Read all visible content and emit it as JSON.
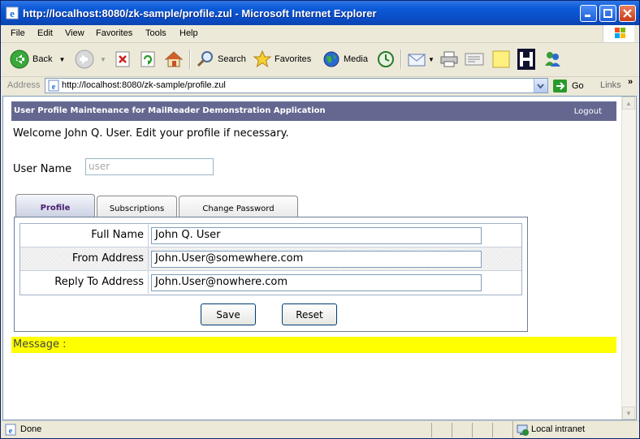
{
  "window": {
    "title": "http://localhost:8080/zk-sample/profile.zul - Microsoft Internet Explorer"
  },
  "menu": {
    "file": "File",
    "edit": "Edit",
    "view": "View",
    "favorites": "Favorites",
    "tools": "Tools",
    "help": "Help"
  },
  "toolbar": {
    "back": "Back",
    "search": "Search",
    "favorites": "Favorites",
    "media": "Media"
  },
  "address": {
    "label": "Address",
    "url": "http://localhost:8080/zk-sample/profile.zul",
    "go": "Go",
    "links": "Links"
  },
  "page": {
    "header_title": "User Profile Maintenance for MailReader Demonstration Application",
    "logout": "Logout",
    "welcome": "Welcome John Q. User. Edit your profile if necessary.",
    "username_label": "User Name",
    "username_value": "user",
    "tabs": [
      {
        "label": "Profile",
        "active": true
      },
      {
        "label": "Subscriptions",
        "active": false
      },
      {
        "label": "Change Password",
        "active": false
      }
    ],
    "fields": [
      {
        "label": "Full Name",
        "value": "John Q. User"
      },
      {
        "label": "From Address",
        "value": "John.User@somewhere.com"
      },
      {
        "label": "Reply To Address",
        "value": "John.User@nowhere.com"
      }
    ],
    "save": "Save",
    "reset": "Reset",
    "message": "Message :"
  },
  "status": {
    "text": "Done",
    "zone": "Local intranet"
  },
  "colors": {
    "header_bg": "#646890",
    "message_bg": "#ffff00",
    "titlebar": "#0a4dc7"
  }
}
